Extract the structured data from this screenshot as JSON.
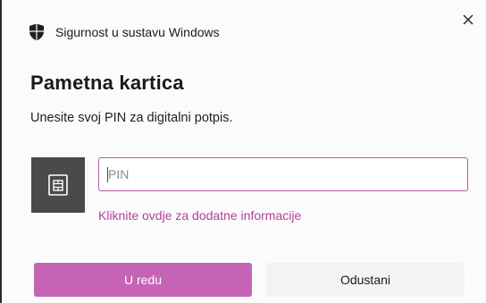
{
  "window": {
    "app_title": "Sigurnost u sustavu Windows",
    "close_icon": "close-icon",
    "app_icon": "shield-icon"
  },
  "dialog": {
    "title": "Pametna kartica",
    "instruction": "Unesite svoj PIN za digitalni potpis.",
    "card_icon": "smart-card-icon",
    "pin_value": "",
    "pin_placeholder": "PIN",
    "more_info_link": "Kliknite ovdje za dodatne informacije",
    "ok_label": "U redu",
    "cancel_label": "Odustani"
  },
  "colors": {
    "accent": "#c564b4",
    "link": "#b0409c",
    "input_border": "#b45aaa",
    "card_box": "#4a4a4a"
  }
}
